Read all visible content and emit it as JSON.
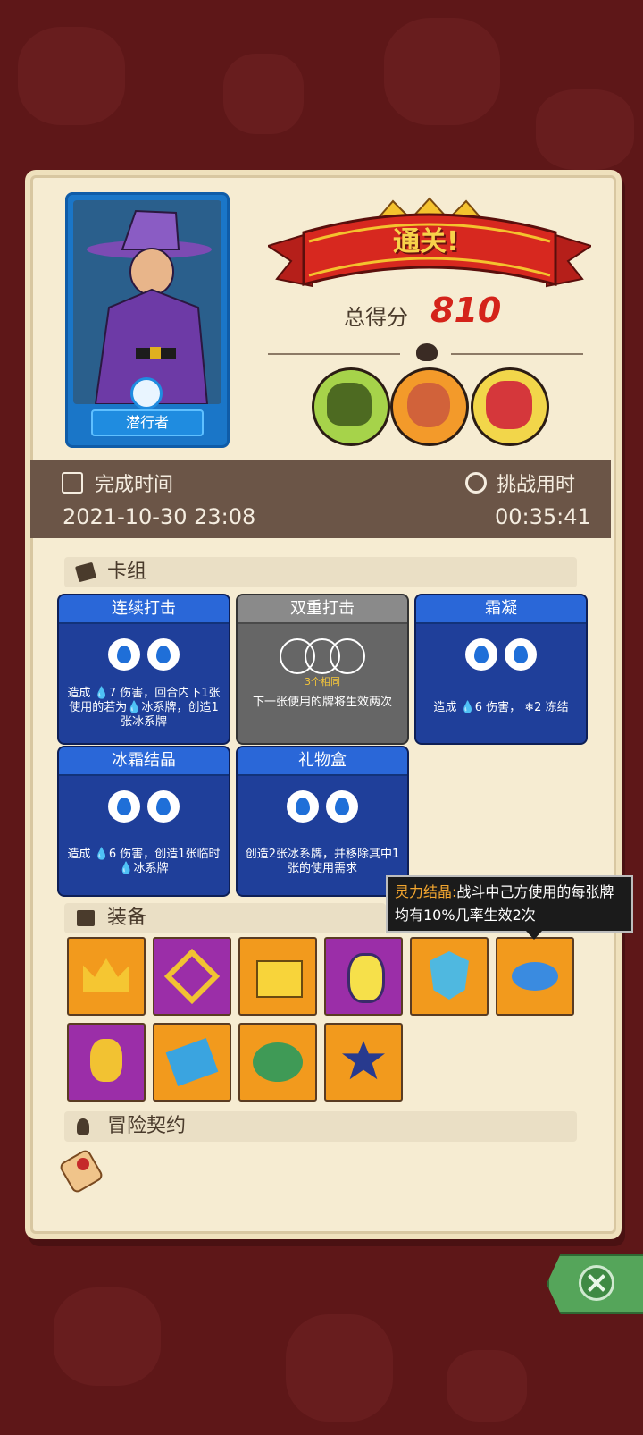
{
  "hero": {
    "name": "潜行者"
  },
  "result": {
    "banner": "通关!",
    "score_label": "总得分",
    "score": "810"
  },
  "bosses": [
    "green-skull-boss-icon",
    "horned-beast-boss-icon",
    "masked-demon-boss-icon"
  ],
  "times": {
    "completion_label": "完成时间",
    "completion_value": "2021-10-30 23:08",
    "duration_label": "挑战用时",
    "duration_value": "00:35:41"
  },
  "deck": {
    "heading": "卡组",
    "cards": [
      {
        "name": "连续打击",
        "style": "blue",
        "cost": 2,
        "desc_html": "造成 💧7 伤害，回合内下1张使用的若为💧冰系牌，创造1张冰系牌"
      },
      {
        "name": "双重打击",
        "style": "grey",
        "cost": 3,
        "note": "3个相同",
        "desc": "下一张使用的牌将生效两次"
      },
      {
        "name": "霜凝",
        "style": "blue",
        "cost": 2,
        "desc": "造成 💧6 伤害， ❄2 冻结"
      },
      {
        "name": "冰霜结晶",
        "style": "blue",
        "cost": 2,
        "desc": "造成 💧6 伤害，创造1张临时💧冰系牌"
      },
      {
        "name": "礼物盒",
        "style": "blue",
        "cost": 2,
        "desc": "创造2张冰系牌，并移除其中1张的使用需求"
      }
    ]
  },
  "equipment": {
    "heading": "装备",
    "items": [
      {
        "name": "crown-icon",
        "bg": "orange"
      },
      {
        "name": "chain-relic-icon",
        "bg": "purple"
      },
      {
        "name": "golden-box-icon",
        "bg": "orange"
      },
      {
        "name": "lantern-icon",
        "bg": "purple"
      },
      {
        "name": "blue-crystal-shield-icon",
        "bg": "orange"
      },
      {
        "name": "spirit-crystal-icon",
        "bg": "orange"
      },
      {
        "name": "heart-gem-icon",
        "bg": "purple"
      },
      {
        "name": "blue-potion-icon",
        "bg": "orange"
      },
      {
        "name": "turtle-shell-icon",
        "bg": "orange"
      },
      {
        "name": "hexagram-icon",
        "bg": "orange"
      }
    ]
  },
  "tooltip": {
    "title": "灵力结晶:",
    "text": "战斗中己方使用的每张牌均有10%几率生效2次"
  },
  "contract": {
    "heading": "冒险契约"
  },
  "colors": {
    "panel": "#f6ecd2",
    "band": "#6b5547",
    "score": "#d4231a",
    "card_blue": "#1f3f9a",
    "close_green": "#55a55a"
  }
}
